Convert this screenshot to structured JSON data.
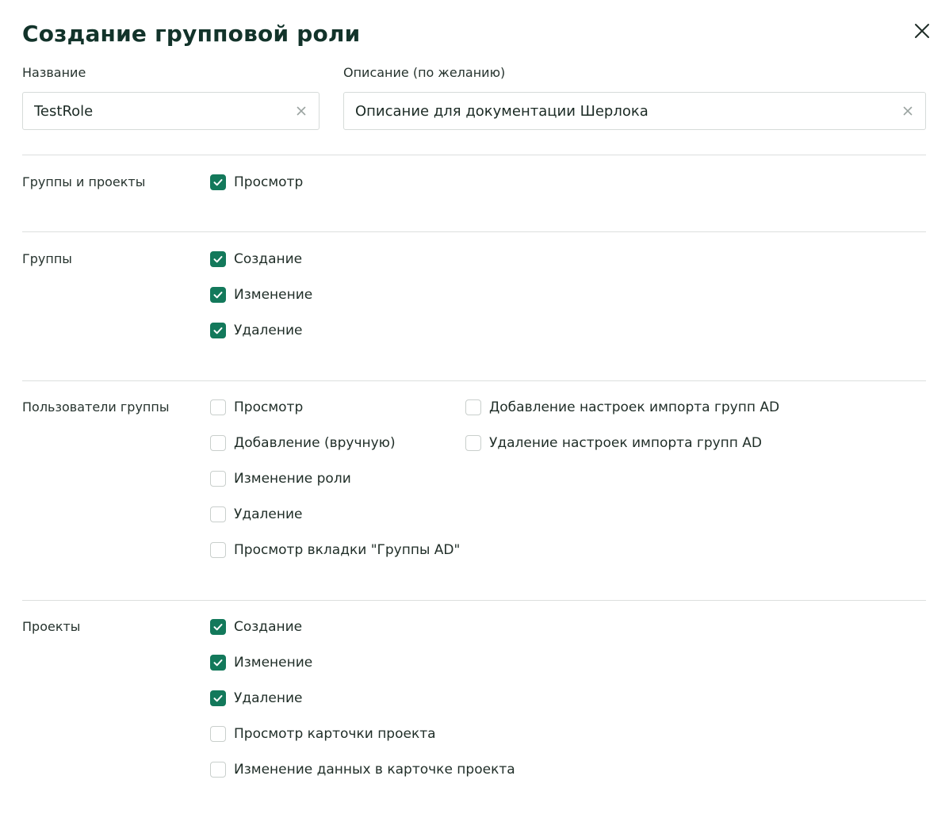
{
  "dialog": {
    "title": "Создание групповой роли"
  },
  "fields": {
    "name": {
      "label": "Название",
      "value": "TestRole"
    },
    "description": {
      "label": "Описание (по желанию)",
      "value": "Описание для документации Шерлока"
    }
  },
  "sections": {
    "groups_projects": {
      "label": "Группы и проекты",
      "items": [
        {
          "label": "Просмотр",
          "checked": true
        }
      ]
    },
    "groups": {
      "label": "Группы",
      "items": [
        {
          "label": "Создание",
          "checked": true
        },
        {
          "label": "Изменение",
          "checked": true
        },
        {
          "label": "Удаление",
          "checked": true
        }
      ]
    },
    "group_users": {
      "label": "Пользователи группы",
      "items": [
        {
          "label": "Просмотр",
          "checked": false
        },
        {
          "label": "Добавление (вручную)",
          "checked": false
        },
        {
          "label": "Изменение роли",
          "checked": false
        },
        {
          "label": "Удаление",
          "checked": false
        },
        {
          "label": "Просмотр вкладки \"Группы AD\"",
          "checked": false
        },
        {
          "label": "Добавление настроек импорта групп AD",
          "checked": false
        },
        {
          "label": "Удаление настроек импорта групп AD",
          "checked": false
        }
      ]
    },
    "projects": {
      "label": "Проекты",
      "items": [
        {
          "label": "Создание",
          "checked": true
        },
        {
          "label": "Изменение",
          "checked": true
        },
        {
          "label": "Удаление",
          "checked": true
        },
        {
          "label": "Просмотр карточки проекта",
          "checked": false
        },
        {
          "label": "Изменение данных в карточке проекта",
          "checked": false
        }
      ]
    }
  },
  "colors": {
    "accent": "#13795b",
    "title": "#12332a",
    "border": "#d6dbd9"
  },
  "icons": {
    "close": "close-icon",
    "clear": "clear-icon",
    "check": "check-icon"
  }
}
